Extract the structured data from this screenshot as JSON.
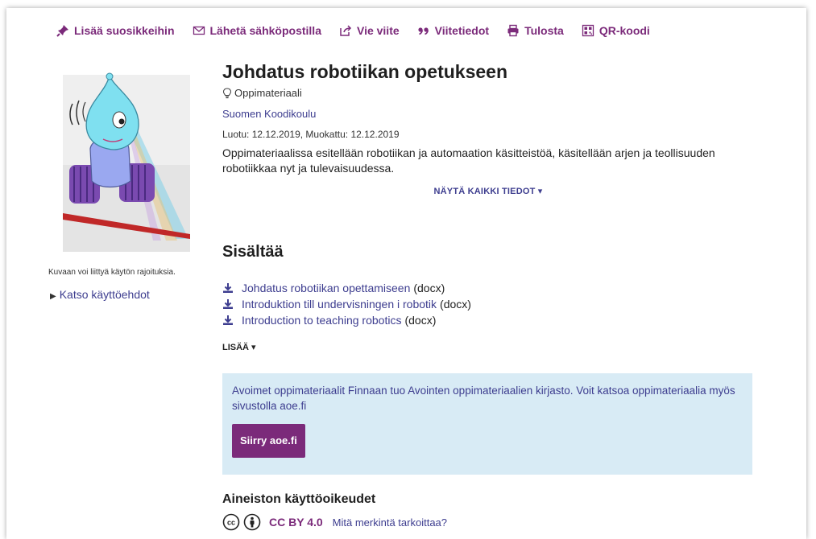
{
  "toolbar": {
    "favorite": "Lisää suosikkeihin",
    "email": "Lähetä sähköpostilla",
    "export": "Vie viite",
    "cite": "Viitetiedot",
    "print": "Tulosta",
    "qr": "QR-koodi"
  },
  "record": {
    "title": "Johdatus robotiikan opetukseen",
    "format": "Oppimateriaali",
    "organization": "Suomen Koodikoulu",
    "dates": "Luotu: 12.12.2019, Muokattu: 12.12.2019",
    "description": "Oppimateriaalissa esitellään robotiikan ja automaation käsitteistöä, käsitellään arjen ja teollisuuden robotiikkaa nyt ja tulevaisuudessa.",
    "show_all": "NÄYTÄ KAIKKI TIEDOT ▾"
  },
  "image": {
    "note": "Kuvaan voi liittyä käytön rajoituksia.",
    "terms_link": "Katso käyttöehdot"
  },
  "contents": {
    "heading": "Sisältää",
    "files": [
      {
        "name": "Johdatus robotiikan opettamiseen",
        "ext": "(docx)"
      },
      {
        "name": "Introduktion till undervisningen i robotik",
        "ext": "(docx)"
      },
      {
        "name": "Introduction to teaching robotics",
        "ext": "(docx)"
      }
    ],
    "more": "LISÄÄ ▾"
  },
  "notice": {
    "text": "Avoimet oppimateriaalit Finnaan tuo Avointen oppimateriaalien kirjasto. Voit katsoa oppimateriaalia myös sivustolla aoe.fi",
    "button": "Siirry aoe.fi"
  },
  "rights": {
    "heading": "Aineiston käyttöoikeudet",
    "license": "CC BY 4.0",
    "what_link": "Mitä merkintä tarkoittaa?"
  },
  "colors": {
    "accent": "#7b2a7a",
    "link": "#3d3d8f",
    "notice_bg": "#d8ebf5"
  }
}
